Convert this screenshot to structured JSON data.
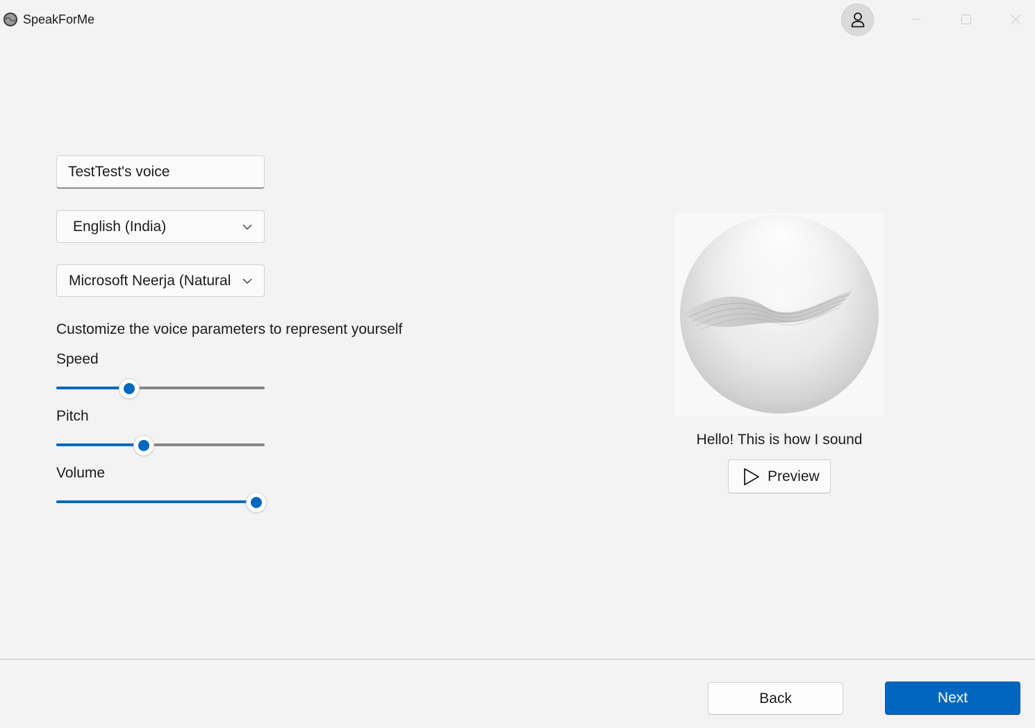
{
  "window": {
    "app_title": "SpeakForMe",
    "app_icon": "app-logo-icon",
    "profile_icon": "person-icon",
    "controls": [
      "minimize-icon",
      "maximize-icon",
      "close-icon"
    ]
  },
  "voice_form": {
    "voice_name_value": "TestTest's voice",
    "language_selected": "English (India)",
    "voice_selected": "Microsoft Neerja (Natural",
    "customize_heading": "Customize the voice parameters to represent yourself",
    "sliders": [
      {
        "label": "Speed",
        "value_fraction": 0.35
      },
      {
        "label": "Pitch",
        "value_fraction": 0.42
      },
      {
        "label": "Volume",
        "value_fraction": 0.96
      }
    ]
  },
  "preview_panel": {
    "caption": "Hello! This is how I sound",
    "preview_label": "Preview",
    "preview_icon": "play-icon"
  },
  "footer": {
    "back_label": "Back",
    "next_label": "Next"
  },
  "colors": {
    "accent": "#0067c0",
    "background": "#f3f3f3",
    "track": "#868686"
  }
}
